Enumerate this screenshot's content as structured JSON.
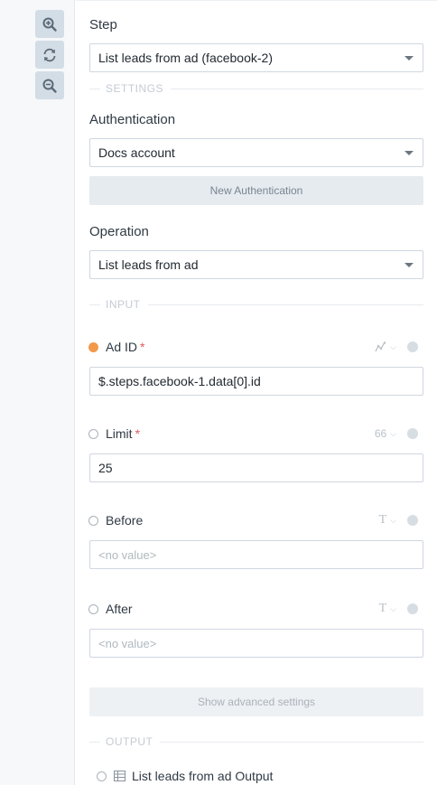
{
  "toolbar": {
    "zoom_in_icon": "zoom-in-icon",
    "refresh_icon": "refresh-icon",
    "zoom_out_icon": "zoom-out-icon"
  },
  "step": {
    "label": "Step",
    "value": "List leads from ad (facebook-2)"
  },
  "settings": {
    "section_label": "SETTINGS",
    "auth_label": "Authentication",
    "auth_value": "Docs account",
    "new_auth_button": "New Authentication",
    "operation_label": "Operation",
    "operation_value": "List leads from ad"
  },
  "input": {
    "section_label": "INPUT",
    "fields": [
      {
        "name": "Ad ID",
        "required": "*",
        "type_icon": "graph-icon",
        "value": "$.steps.facebook-1.data[0].id",
        "status": "filled"
      },
      {
        "name": "Limit",
        "required": "*",
        "type_icon": "66",
        "value": "25",
        "status": "empty"
      },
      {
        "name": "Before",
        "type_icon": "T",
        "placeholder": "<no value>",
        "status": "empty"
      },
      {
        "name": "After",
        "type_icon": "T",
        "placeholder": "<no value>",
        "status": "empty"
      }
    ],
    "advanced_button": "Show advanced settings"
  },
  "output": {
    "section_label": "OUTPUT",
    "item_label": "List leads from ad Output"
  },
  "colors": {
    "accent_orange": "#f2994a",
    "required_red": "#e05a5a",
    "rail_bg": "#f6f8fa"
  }
}
